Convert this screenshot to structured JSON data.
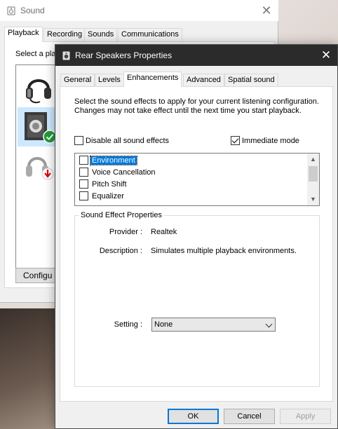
{
  "sound_window": {
    "title": "Sound",
    "close_glyph": "✕",
    "tabs": [
      "Playback",
      "Recording",
      "Sounds",
      "Communications"
    ],
    "active_tab": "Playback",
    "select_text": "Select a playb",
    "devices": [
      {
        "icon": "headset-icon",
        "selected": false,
        "status_icon": null
      },
      {
        "icon": "speaker-icon",
        "selected": true,
        "status_icon": "default-device-check-icon"
      },
      {
        "icon": "headphones-icon",
        "selected": false,
        "status_icon": "unplugged-arrow-icon"
      }
    ],
    "configure_label": "Configu"
  },
  "dialog": {
    "title": "Rear Speakers Properties",
    "close_glyph": "✕",
    "tabs": [
      "General",
      "Levels",
      "Enhancements",
      "Advanced",
      "Spatial sound"
    ],
    "active_tab": "Enhancements",
    "intro_text": "Select the sound effects to apply for your current listening configuration. Changes may not take effect until the next time you start playback.",
    "disable_all": {
      "label": "Disable all sound effects",
      "checked": false
    },
    "immediate_mode": {
      "label": "Immediate mode",
      "checked": true
    },
    "effects": [
      {
        "label": "Environment",
        "checked": false,
        "selected": true
      },
      {
        "label": "Voice Cancellation",
        "checked": false,
        "selected": false
      },
      {
        "label": "Pitch Shift",
        "checked": false,
        "selected": false
      },
      {
        "label": "Equalizer",
        "checked": false,
        "selected": false
      }
    ],
    "properties": {
      "legend": "Sound Effect Properties",
      "provider_label": "Provider :",
      "provider_value": "Realtek",
      "description_label": "Description :",
      "description_value": "Simulates multiple playback environments.",
      "setting_label": "Setting :",
      "setting_value": "None"
    },
    "buttons": {
      "ok": "OK",
      "cancel": "Cancel",
      "apply": "Apply"
    },
    "apply_enabled": false
  },
  "colors": {
    "accent": "#0078d7",
    "dialog_titlebar": "#2b2b2b",
    "selection": "#cce8ff"
  }
}
